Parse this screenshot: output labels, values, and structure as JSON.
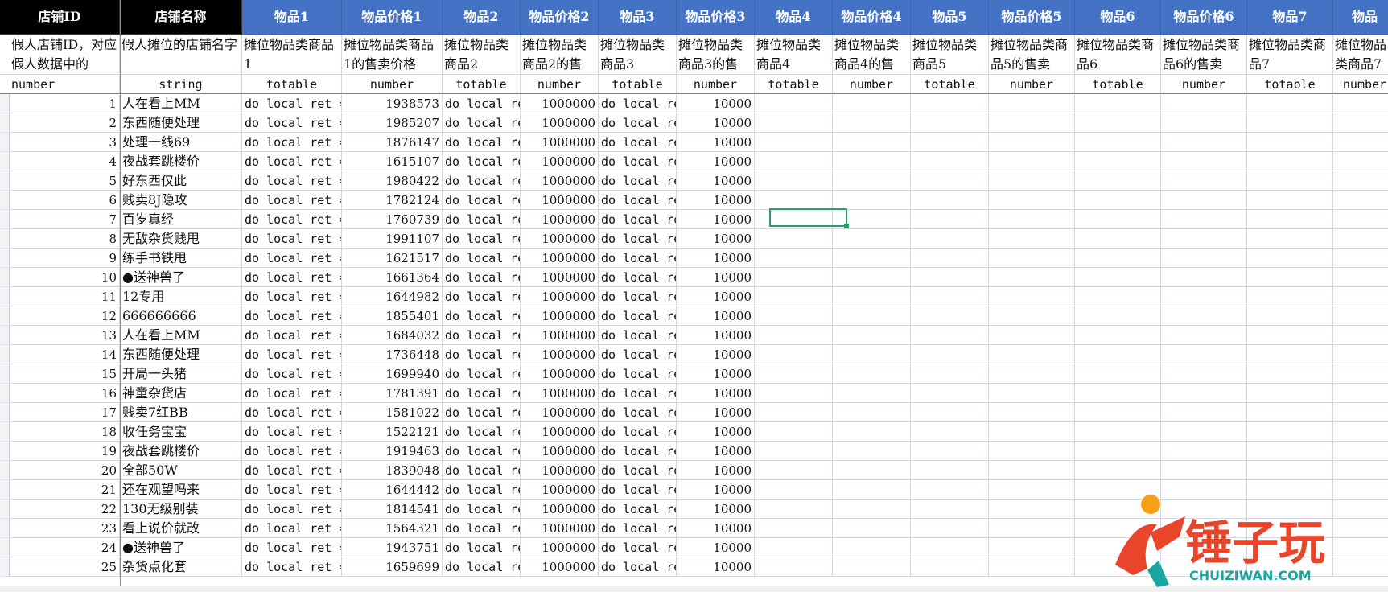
{
  "headers": [
    {
      "label": "店铺ID",
      "desc": "假人店铺ID，对应假人数据中的",
      "type": "number",
      "style": "dark"
    },
    {
      "label": "店铺名称",
      "desc": "假人摊位的店铺名字",
      "type": "string",
      "style": "dark"
    },
    {
      "label": "物品1",
      "desc": "摊位物品类商品1",
      "type": "totable",
      "style": "blue"
    },
    {
      "label": "物品价格1",
      "desc": "摊位物品类商品1的售卖价格",
      "type": "number",
      "style": "blue"
    },
    {
      "label": "物品2",
      "desc": "摊位物品类商品2",
      "type": "totable",
      "style": "blue"
    },
    {
      "label": "物品价格2",
      "desc": "摊位物品类商品2的售",
      "type": "number",
      "style": "blue"
    },
    {
      "label": "物品3",
      "desc": "摊位物品类商品3",
      "type": "totable",
      "style": "blue"
    },
    {
      "label": "物品价格3",
      "desc": "摊位物品类商品3的售",
      "type": "number",
      "style": "blue"
    },
    {
      "label": "物品4",
      "desc": "摊位物品类商品4",
      "type": "totable",
      "style": "blue"
    },
    {
      "label": "物品价格4",
      "desc": "摊位物品类商品4的售",
      "type": "number",
      "style": "blue"
    },
    {
      "label": "物品5",
      "desc": "摊位物品类商品5",
      "type": "totable",
      "style": "blue"
    },
    {
      "label": "物品价格5",
      "desc": "摊位物品类商品5的售卖",
      "type": "number",
      "style": "blue"
    },
    {
      "label": "物品6",
      "desc": "摊位物品类商品6",
      "type": "totable",
      "style": "blue"
    },
    {
      "label": "物品价格6",
      "desc": "摊位物品类商品6的售卖",
      "type": "number",
      "style": "blue"
    },
    {
      "label": "物品7",
      "desc": "摊位物品类商品7",
      "type": "totable",
      "style": "blue"
    },
    {
      "label": "物品",
      "desc": "摊位物品类商品7",
      "type": "number",
      "style": "blue"
    }
  ],
  "code_text_col2": "do local ret =",
  "code_text_short": "do local re",
  "price2": "1000000",
  "price3": "10000",
  "rows": [
    {
      "id": "1",
      "name": "人在看上MM",
      "price1": "1938573"
    },
    {
      "id": "2",
      "name": "东西随便处理",
      "price1": "1985207"
    },
    {
      "id": "3",
      "name": "处理一线69",
      "price1": "1876147"
    },
    {
      "id": "4",
      "name": "夜战套跳楼价",
      "price1": "1615107"
    },
    {
      "id": "5",
      "name": "好东西仅此",
      "price1": "1980422"
    },
    {
      "id": "6",
      "name": "贱卖8J隐攻",
      "price1": "1782124"
    },
    {
      "id": "7",
      "name": "百岁真经",
      "price1": "1760739"
    },
    {
      "id": "8",
      "name": "无敌杂货贱甩",
      "price1": "1991107"
    },
    {
      "id": "9",
      "name": "练手书铁甩",
      "price1": "1621517"
    },
    {
      "id": "10",
      "name": "●送神兽了",
      "price1": "1661364"
    },
    {
      "id": "11",
      "name": "12专用",
      "price1": "1644982"
    },
    {
      "id": "12",
      "name": "666666666",
      "price1": "1855401"
    },
    {
      "id": "13",
      "name": "人在看上MM",
      "price1": "1684032"
    },
    {
      "id": "14",
      "name": "东西随便处理",
      "price1": "1736448"
    },
    {
      "id": "15",
      "name": "开局一头猪",
      "price1": "1699940"
    },
    {
      "id": "16",
      "name": "神童杂货店",
      "price1": "1781391"
    },
    {
      "id": "17",
      "name": "贱卖7红BB",
      "price1": "1581022"
    },
    {
      "id": "18",
      "name": "收任务宝宝",
      "price1": "1522121"
    },
    {
      "id": "19",
      "name": "夜战套跳楼价",
      "price1": "1919463"
    },
    {
      "id": "20",
      "name": "全部50W",
      "price1": "1839048"
    },
    {
      "id": "21",
      "name": "还在观望吗来",
      "price1": "1644442"
    },
    {
      "id": "22",
      "name": "130无级别装",
      "price1": "1814541"
    },
    {
      "id": "23",
      "name": "看上说价就改",
      "price1": "1564321"
    },
    {
      "id": "24",
      "name": "●送神兽了",
      "price1": "1943751"
    },
    {
      "id": "25",
      "name": "杂货点化套",
      "price1": "1659699"
    }
  ],
  "watermark": {
    "brand": "锤子玩",
    "url": "CHUIZIWAN.COM",
    "colors": {
      "orange": "#f6a019",
      "red": "#e8452a",
      "teal": "#1aa5a0"
    }
  },
  "colors": {
    "header_dark": "#000000",
    "header_blue": "#4472c4",
    "selection": "#21a366"
  }
}
